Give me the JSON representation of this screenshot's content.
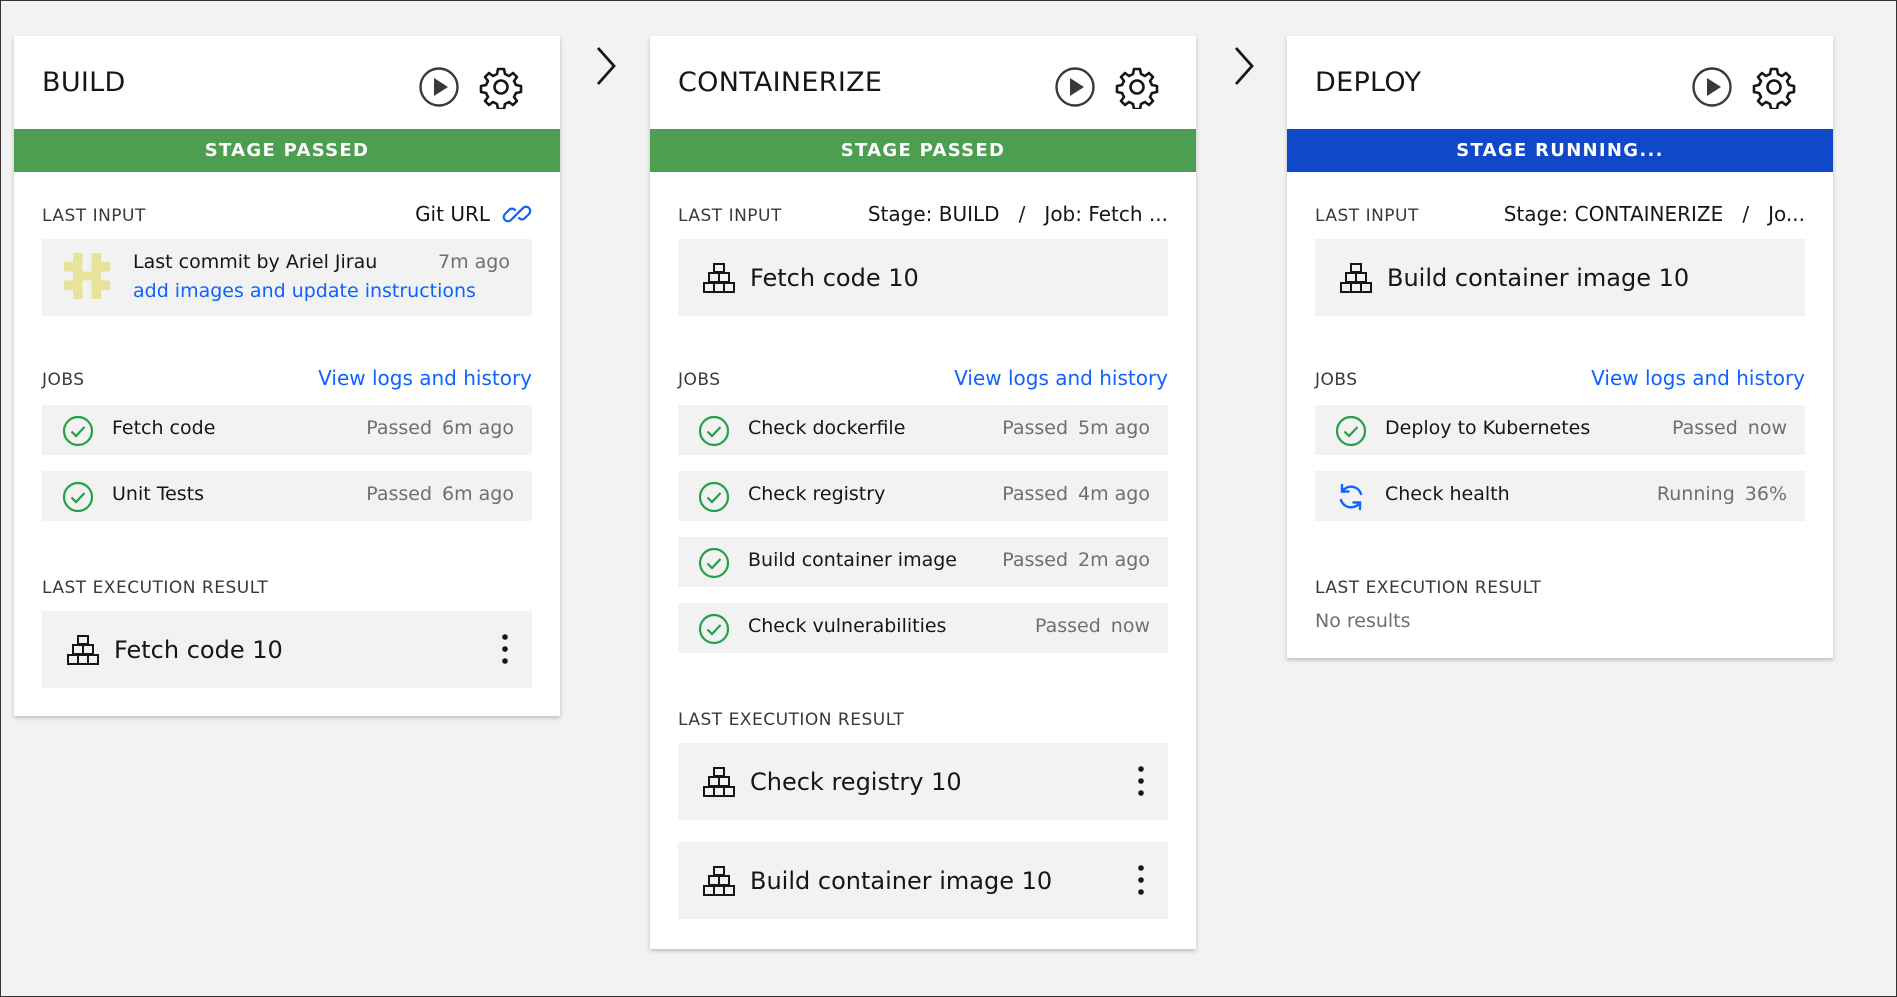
{
  "colors": {
    "passed": "#4d9e51",
    "running": "#0f48c8",
    "link": "#0f62fe",
    "check": "#24a148"
  },
  "stages": [
    {
      "title": "BUILD",
      "status": "STAGE PASSED",
      "last_input_label": "LAST INPUT",
      "last_input_value": "Git URL",
      "commit": {
        "by": "Last commit by Ariel Jirau",
        "time": "7m ago",
        "message": "add images and update instructions"
      },
      "jobs_label": "JOBS",
      "jobs_link": "View logs and history",
      "jobs": [
        {
          "name": "Fetch code",
          "status": "Passed",
          "time": "6m ago"
        },
        {
          "name": "Unit Tests",
          "status": "Passed",
          "time": "6m ago"
        }
      ],
      "result_label": "LAST EXECUTION RESULT",
      "results": [
        "Fetch code 10"
      ]
    },
    {
      "title": "CONTAINERIZE",
      "status": "STAGE PASSED",
      "last_input_label": "LAST INPUT",
      "last_input_value": "Stage: BUILD   /   Job: Fetch ...",
      "input_tile": "Fetch code 10",
      "jobs_label": "JOBS",
      "jobs_link": "View logs and history",
      "jobs": [
        {
          "name": "Check dockerfile",
          "status": "Passed",
          "time": "5m ago"
        },
        {
          "name": "Check registry",
          "status": "Passed",
          "time": "4m ago"
        },
        {
          "name": "Build container image",
          "status": "Passed",
          "time": "2m ago"
        },
        {
          "name": "Check vulnerabilities",
          "status": "Passed",
          "time": "now"
        }
      ],
      "result_label": "LAST EXECUTION RESULT",
      "results": [
        "Check registry 10",
        "Build container image 10"
      ]
    },
    {
      "title": "DEPLOY",
      "status": "STAGE RUNNING...",
      "last_input_label": "LAST INPUT",
      "last_input_value": "Stage: CONTAINERIZE   /   Jo...",
      "input_tile": "Build container image 10",
      "jobs_label": "JOBS",
      "jobs_link": "View logs and history",
      "jobs": [
        {
          "name": "Deploy to Kubernetes",
          "status": "Passed",
          "time": "now"
        },
        {
          "name": "Check health",
          "status": "Running",
          "time": "36%"
        }
      ],
      "result_label": "LAST EXECUTION RESULT",
      "no_results": "No results"
    }
  ]
}
